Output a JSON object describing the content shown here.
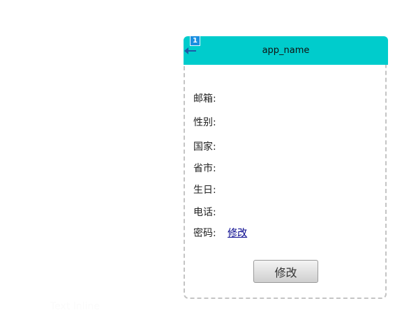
{
  "background_hint": "Text  Inline",
  "header": {
    "title": "app_name",
    "badge": "1",
    "back_icon": "back-arrow-icon",
    "color": "#00cccc"
  },
  "fields": [
    {
      "label": "邮箱:"
    },
    {
      "label": "性别:"
    },
    {
      "label": "国家:"
    },
    {
      "label": "省市:"
    },
    {
      "label": "生日:"
    },
    {
      "label": "电话:"
    },
    {
      "label": "密码:",
      "link": "修改"
    }
  ],
  "submit_label": "修改"
}
